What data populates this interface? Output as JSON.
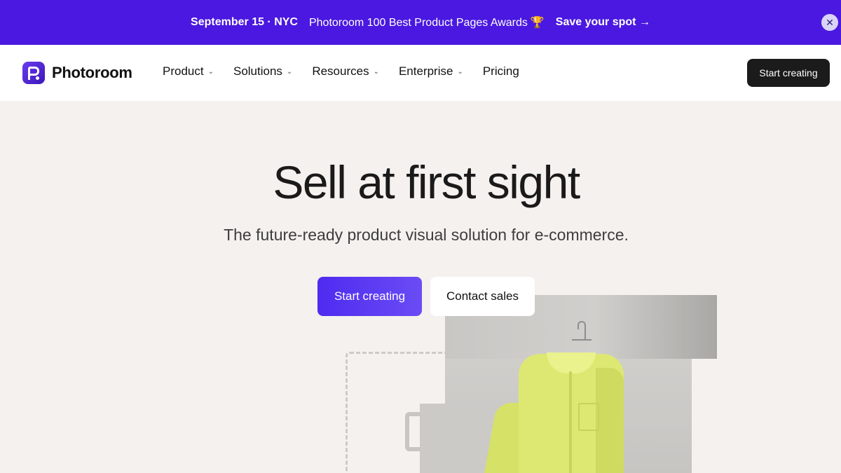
{
  "banner": {
    "date": "September 15 · NYC",
    "award": "Photoroom 100 Best Product Pages Awards",
    "trophy_icon": "trophy-icon",
    "cta": "Save your spot →",
    "close_icon": "close-icon"
  },
  "nav": {
    "logo_text": "Photoroom",
    "items": [
      {
        "label": "Product",
        "has_dropdown": true
      },
      {
        "label": "Solutions",
        "has_dropdown": true
      },
      {
        "label": "Resources",
        "has_dropdown": true
      },
      {
        "label": "Enterprise",
        "has_dropdown": true
      },
      {
        "label": "Pricing",
        "has_dropdown": false
      }
    ],
    "cta_label": "Start creating"
  },
  "hero": {
    "title": "Sell at first sight",
    "subtitle": "The future-ready product visual solution for e-commerce.",
    "primary_cta": "Start creating",
    "secondary_cta": "Contact sales"
  },
  "colors": {
    "banner_bg": "#4a18e0",
    "page_bg": "#f5f1ee",
    "primary_button": "#5a38f2",
    "dark_button": "#1b1b1b"
  }
}
